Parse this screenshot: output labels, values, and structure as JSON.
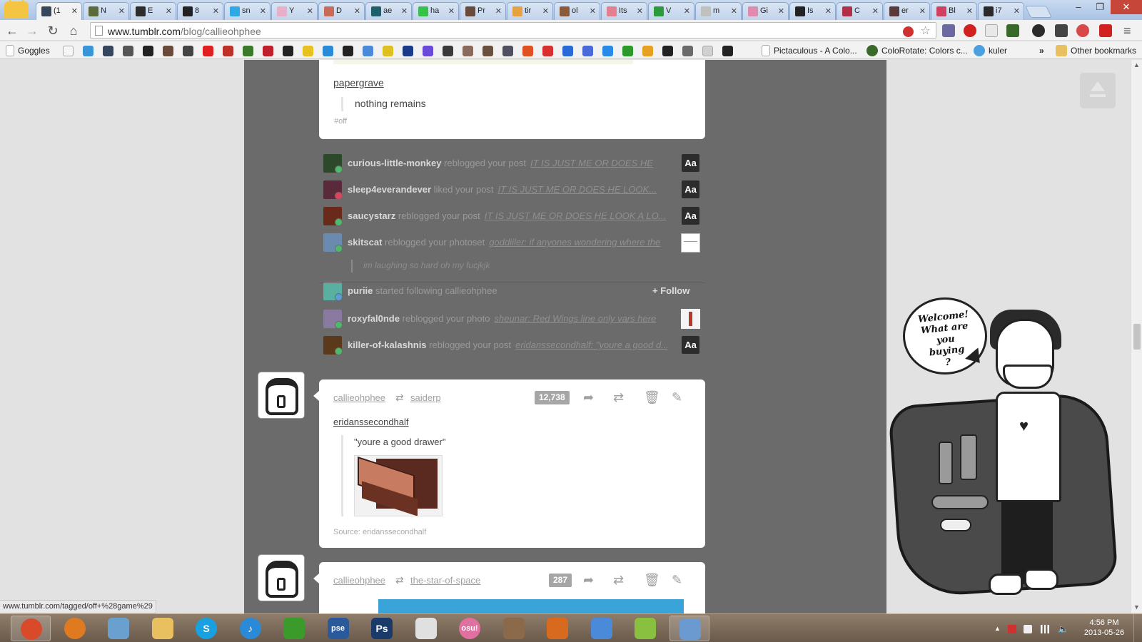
{
  "browser": {
    "tabs": [
      {
        "label": "(1",
        "color": "#36465d",
        "active": true
      },
      {
        "label": "N",
        "color": "#5b6b3a"
      },
      {
        "label": "E",
        "color": "#2d2d2d"
      },
      {
        "label": "8",
        "color": "#222222"
      },
      {
        "label": "sn",
        "color": "#2fa9e6"
      },
      {
        "label": "Y",
        "color": "#e8b0c8"
      },
      {
        "label": "D",
        "color": "#c96a5a"
      },
      {
        "label": "ae",
        "color": "#1f5f6a"
      },
      {
        "label": "ha",
        "color": "#36c24a"
      },
      {
        "label": "Pr",
        "color": "#6a4a3a"
      },
      {
        "label": "tir",
        "color": "#e6a140"
      },
      {
        "label": "ol",
        "color": "#8a5a3a"
      },
      {
        "label": "Its",
        "color": "#e28090"
      },
      {
        "label": "V",
        "color": "#2a9a3a"
      },
      {
        "label": "m",
        "color": "#c0c0c0"
      },
      {
        "label": "Gi",
        "color": "#e08ab0"
      },
      {
        "label": "Is",
        "color": "#222222"
      },
      {
        "label": "C",
        "color": "#b0304a"
      },
      {
        "label": "er",
        "color": "#5a3a3a"
      },
      {
        "label": "Bl",
        "color": "#d04060"
      },
      {
        "label": "i7",
        "color": "#2a2a2a"
      }
    ],
    "url_host": "www.tumblr.com",
    "url_path": "/blog/callieohphee",
    "status_url": "www.tumblr.com/tagged/off+%28game%29"
  },
  "bookmarks": {
    "first_label": "Goggles",
    "pictaculous": "Pictaculous - A Colo...",
    "colorotate": "ColoRotate: Colors c...",
    "kuler": "kuler",
    "overflow": "»",
    "other": "Other bookmarks",
    "icon_colors": [
      "#f6f6f6",
      "#3a94d8",
      "#35465c",
      "#555",
      "#222",
      "#6a4a3a",
      "#444",
      "#e02020",
      "#c0302a",
      "#3a7a2a",
      "#c0202a",
      "#222",
      "#e8c020",
      "#2a8ad8",
      "#222",
      "#4a8ad8",
      "#e0c020",
      "#1a3a8a",
      "#6a4ad8",
      "#3a3a3a",
      "#8a6a5a",
      "#6a5040",
      "#505060",
      "#e05020",
      "#d83030",
      "#2a6ad8",
      "#4a6ad8",
      "#2a8ae8",
      "#2a9a2a",
      "#e8a020",
      "#222",
      "#6a6a6a",
      "#d0d0d0",
      "#222"
    ]
  },
  "posts": {
    "top": {
      "reblogged_from": "papergrave",
      "quote": "nothing remains",
      "tag": "#off"
    },
    "notifications": [
      {
        "user": "curious-little-monkey",
        "action": "reblogged your post",
        "excerpt": "IT IS JUST ME OR DOES HE",
        "badge": "rb",
        "thumb": "Aa",
        "avatar": "#2c4a2a"
      },
      {
        "user": "sleep4everandever",
        "action": "liked your post",
        "excerpt": "IT IS JUST ME OR DOES HE LOOK...",
        "badge": "like",
        "thumb": "Aa",
        "avatar": "#5a2a3a"
      },
      {
        "user": "saucystarz",
        "action": "reblogged your post",
        "excerpt": "IT IS JUST ME OR DOES HE LOOK A LO...",
        "badge": "rb",
        "thumb": "Aa",
        "avatar": "#6a2a1a"
      },
      {
        "user": "skitscat",
        "action": "reblogged your photoset",
        "excerpt": "goddiiler: if anyones wondering where the",
        "badge": "rb",
        "thumb": "photo",
        "avatar": "#6a8ab0"
      },
      {
        "user": "puriie",
        "action": "started following callieohphee",
        "excerpt": "",
        "badge": "follow",
        "thumb": "follow",
        "avatar": "#5ab0a0"
      },
      {
        "user": "roxyfal0nde",
        "action": "reblogged your photo",
        "excerpt": "sheunar: Red Wings line only vars here",
        "badge": "rb",
        "thumb": "figure",
        "avatar": "#8a7aa0"
      },
      {
        "user": "killer-of-kalashnis",
        "action": "reblogged your post",
        "excerpt": "eridanssecondhalf: \"youre a good d...",
        "badge": "rb",
        "thumb": "Aa",
        "avatar": "#5a3a1a"
      }
    ],
    "notification_sub_quote": "im laughing so hard oh my fucjkjk",
    "follow_label": "+ Follow",
    "thumb_aa": "Aa",
    "post2": {
      "author": "callieohphee",
      "source": "saiderp",
      "notes": "12,738",
      "reblogged_from": "eridanssecondhalf",
      "quote": "\"youre a good drawer\"",
      "source_line": "Source: eridanssecondhalf"
    },
    "post3": {
      "author": "callieohphee",
      "source": "the-star-of-space",
      "notes": "287"
    }
  },
  "illustration": {
    "bubble_lines": [
      "Welcome!",
      "What are",
      "you",
      "buying",
      "?"
    ]
  },
  "taskbar": {
    "apps": [
      {
        "name": "chrome",
        "color": "#d84a2a",
        "glyph": "",
        "active": true
      },
      {
        "name": "firefox",
        "color": "#e07a20",
        "glyph": ""
      },
      {
        "name": "paint",
        "color": "#6aa0d0",
        "glyph": ""
      },
      {
        "name": "explorer",
        "color": "#e8c060",
        "glyph": ""
      },
      {
        "name": "skype",
        "color": "#18a0e0",
        "glyph": "S"
      },
      {
        "name": "itunes",
        "color": "#2a8ad8",
        "glyph": "♪"
      },
      {
        "name": "app-green",
        "color": "#3a9a2a",
        "glyph": ""
      },
      {
        "name": "pse",
        "color": "#2a5a9a",
        "glyph": "pse"
      },
      {
        "name": "photoshop",
        "color": "#1a3a6a",
        "glyph": "Ps"
      },
      {
        "name": "notepad",
        "color": "#e0e0e0",
        "glyph": ""
      },
      {
        "name": "osu",
        "color": "#e070a0",
        "glyph": "osu!"
      },
      {
        "name": "app-fox",
        "color": "#8a6a4a",
        "glyph": ""
      },
      {
        "name": "app-mushroom",
        "color": "#d86a20",
        "glyph": ""
      },
      {
        "name": "app-blue",
        "color": "#4a8ad8",
        "glyph": ""
      },
      {
        "name": "app-color",
        "color": "#8ac040",
        "glyph": ""
      },
      {
        "name": "app-window",
        "color": "#6a9ad0",
        "glyph": "",
        "active": true
      }
    ],
    "time": "4:56 PM",
    "date": "2013-05-26"
  }
}
